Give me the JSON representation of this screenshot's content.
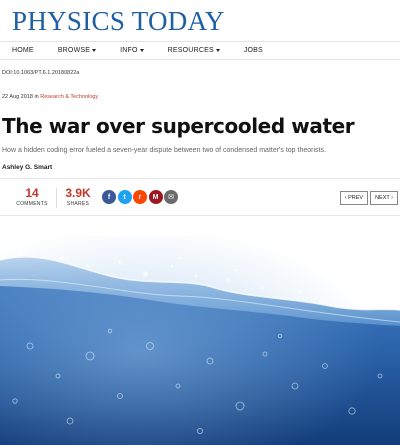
{
  "site": {
    "logo": "PHYSICS TODAY"
  },
  "nav": {
    "items": [
      {
        "label": "HOME",
        "dropdown": false
      },
      {
        "label": "BROWSE",
        "dropdown": true
      },
      {
        "label": "INFO",
        "dropdown": true
      },
      {
        "label": "RESOURCES",
        "dropdown": true
      },
      {
        "label": "JOBS",
        "dropdown": false
      }
    ]
  },
  "article": {
    "doi": "DOI:10.1063/PT.6.1.20180822a",
    "date": "22 Aug 2018",
    "in_label": "in",
    "category": "Research & Technology",
    "title": "The war over supercooled water",
    "dek": "How a hidden coding error fueled a seven-year dispute between two of condensed matter's top theorists.",
    "author": "Ashley G. Smart"
  },
  "stats": {
    "comments_count": "14",
    "comments_label": "COMMENTS",
    "shares_count": "3.9K",
    "shares_label": "SHARES"
  },
  "share_buttons": [
    {
      "icon": "facebook-icon",
      "glyph": "f",
      "color": "#3b5998"
    },
    {
      "icon": "twitter-icon",
      "glyph": "t",
      "color": "#1da1f2"
    },
    {
      "icon": "reddit-icon",
      "glyph": "r",
      "color": "#ff4500"
    },
    {
      "icon": "mendeley-icon",
      "glyph": "M",
      "color": "#9d1620"
    },
    {
      "icon": "email-icon",
      "glyph": "✉",
      "color": "#6b6b6b"
    }
  ],
  "pager": {
    "prev": "‹ PREV",
    "next": "NEXT ›"
  },
  "hero": {
    "image_subject": "water-wave-photo"
  },
  "colors": {
    "brand": "#1f5fa3",
    "accent": "#c0392b"
  }
}
